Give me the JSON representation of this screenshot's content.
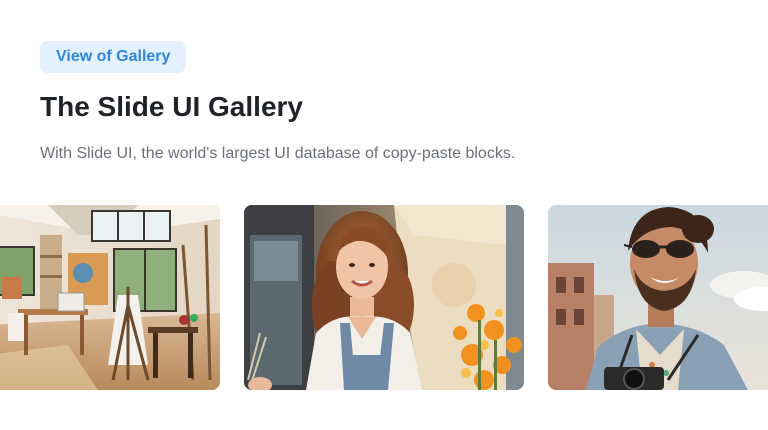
{
  "header": {
    "badge_label": "View of Gallery",
    "title": "The Slide UI Gallery",
    "subtitle": "With Slide UI, the world's largest UI database of copy-paste blocks."
  },
  "gallery": {
    "images": [
      {
        "subject": "art studio interior with easels and paintings"
      },
      {
        "subject": "smiling woman painter with canvas and flowers"
      },
      {
        "subject": "smiling bearded man with sunglasses and camera"
      }
    ]
  }
}
